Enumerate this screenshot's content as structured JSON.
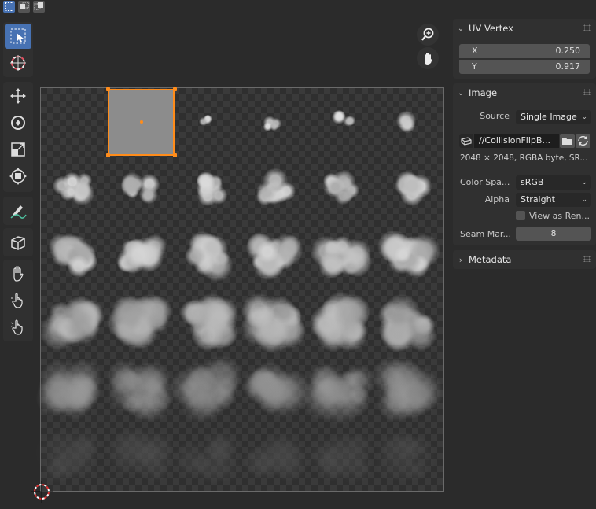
{
  "uv_vertex": {
    "title": "UV Vertex",
    "x_label": "X",
    "x_value": "0.250",
    "y_label": "Y",
    "y_value": "0.917"
  },
  "image_panel": {
    "title": "Image",
    "source_label": "Source",
    "source_value": "Single Image",
    "filepath": "//CollisionFlipB...",
    "info": "2048 × 2048,  RGBA byte,  SR...",
    "colorspace_label": "Color Spa...",
    "colorspace_value": "sRGB",
    "alpha_label": "Alpha",
    "alpha_value": "Straight",
    "view_as_render_label": "View as Ren...",
    "seam_label": "Seam Mar...",
    "seam_value": "8"
  },
  "metadata_panel": {
    "title": "Metadata"
  },
  "icons": {
    "select_box": "select-box-icon",
    "cursor": "cursor-icon",
    "move": "move-icon",
    "rotate": "rotate-icon",
    "scale": "scale-icon",
    "transform": "transform-icon",
    "annotate": "annotate-icon",
    "cube": "cube-icon",
    "grab": "grab-icon",
    "relax": "relax-icon",
    "pinch": "pinch-icon",
    "zoom": "zoom-icon",
    "pan": "pan-hand-icon"
  },
  "colors": {
    "accent": "#4772b3",
    "selection": "#ff8c1a",
    "panel": "#303030",
    "background": "#2b2b2b"
  }
}
